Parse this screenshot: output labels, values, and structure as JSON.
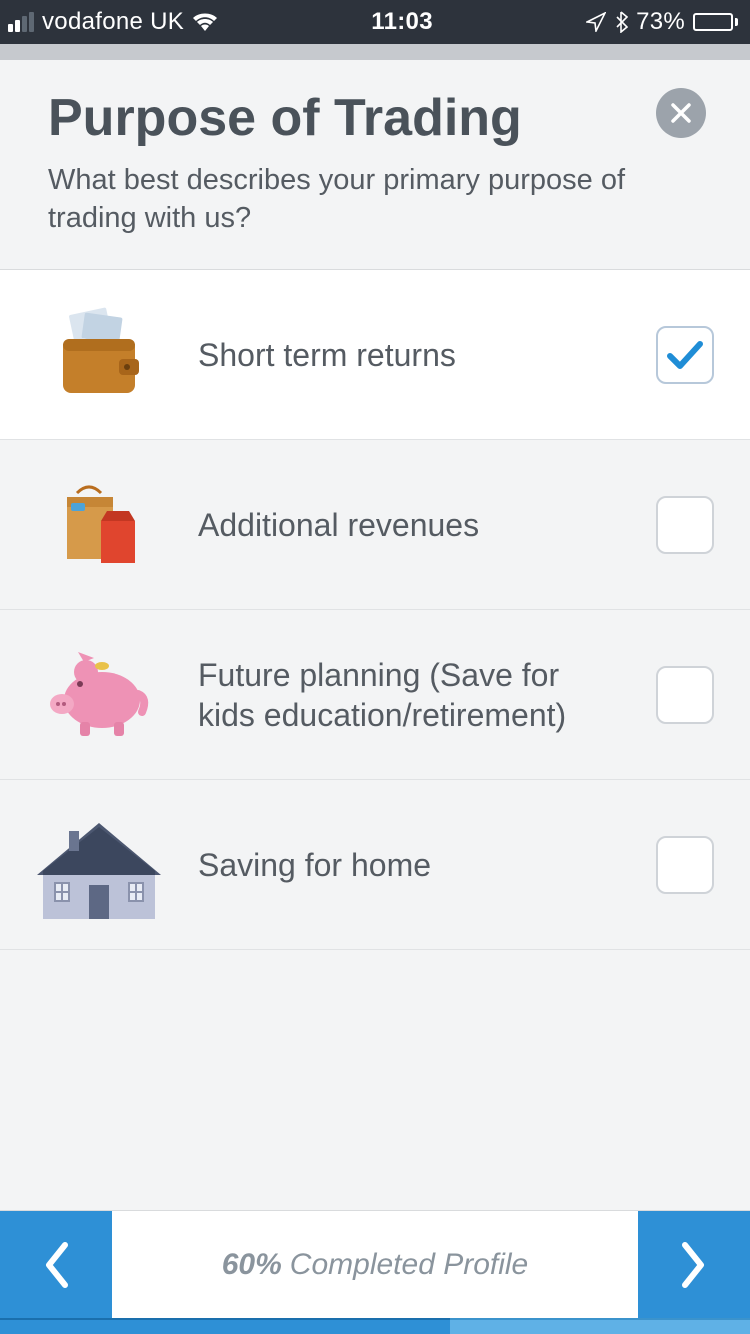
{
  "statusbar": {
    "carrier": "vodafone UK",
    "time": "11:03",
    "battery_pct": "73%"
  },
  "header": {
    "title": "Purpose of Trading",
    "subtitle": "What best describes your primary purpose of trading with us?"
  },
  "options": [
    {
      "label": "Short term returns",
      "selected": true,
      "icon": "wallet-icon"
    },
    {
      "label": "Additional revenues",
      "selected": false,
      "icon": "shopping-bags-icon"
    },
    {
      "label": "Future planning (Save for kids education/retirement)",
      "selected": false,
      "icon": "piggy-bank-icon"
    },
    {
      "label": "Saving for home",
      "selected": false,
      "icon": "house-icon"
    }
  ],
  "footer": {
    "pct": "60%",
    "label": "Completed Profile"
  },
  "chart_data": {
    "type": "bar",
    "title": "Profile completion",
    "categories": [
      "Completed Profile"
    ],
    "values": [
      60
    ],
    "ylim": [
      0,
      100
    ],
    "xlabel": "",
    "ylabel": "%"
  }
}
